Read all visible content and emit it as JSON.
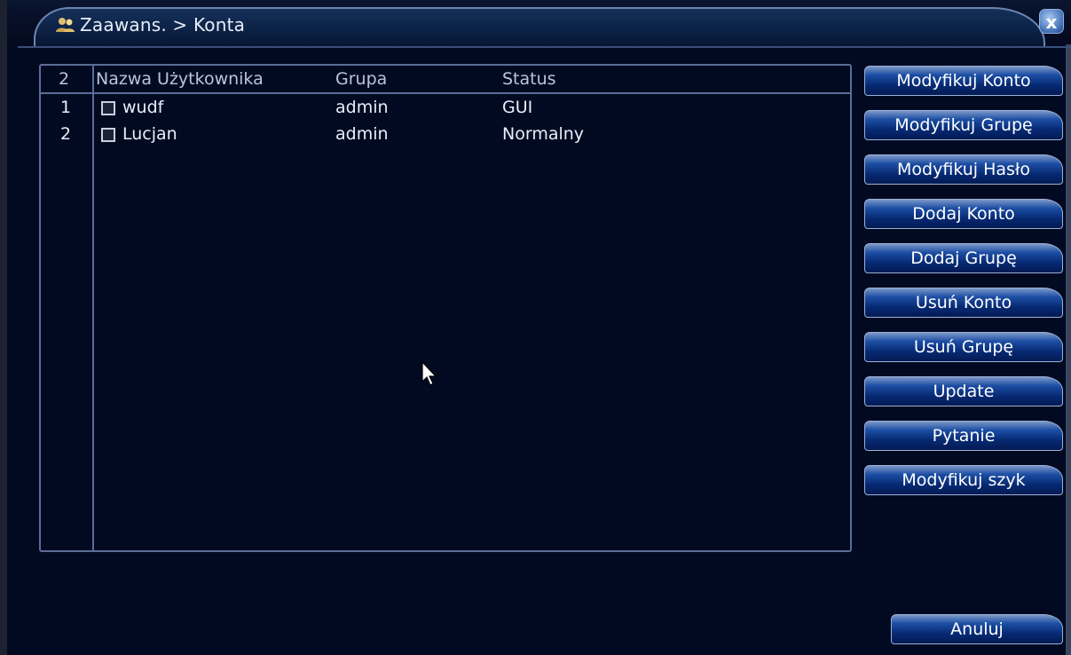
{
  "window": {
    "title": "Zaawans. > Konta",
    "title_icon": "users-icon",
    "close_label": "x"
  },
  "table": {
    "count": "2",
    "headers": [
      "Nazwa Użytkownika",
      "Grupa",
      "Status"
    ],
    "rows": [
      {
        "index": "1",
        "name": "wudf",
        "group": "admin",
        "status": "GUI",
        "checked": false
      },
      {
        "index": "2",
        "name": "Lucjan",
        "group": "admin",
        "status": "Normalny",
        "checked": false
      }
    ]
  },
  "actions": [
    "Modyfikuj Konto",
    "Modyfikuj Grupę",
    "Modyfikuj Hasło",
    "Dodaj Konto",
    "Dodaj Grupę",
    "Usuń Konto",
    "Usuń Grupę",
    "Update",
    "Pytanie",
    "Modyfikuj szyk"
  ],
  "cancel_label": "Anuluj",
  "colors": {
    "background": "#020a22",
    "accent": "#1c4ea4",
    "border": "#5a6e96",
    "text": "#e8eef8"
  }
}
